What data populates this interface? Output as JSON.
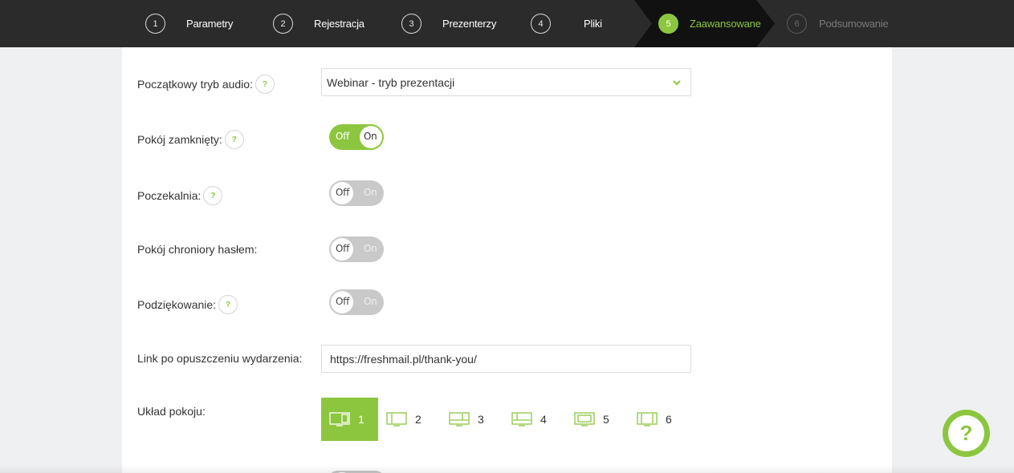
{
  "stepper": {
    "steps": [
      {
        "num": "1",
        "label": "Parametry"
      },
      {
        "num": "2",
        "label": "Rejestracja"
      },
      {
        "num": "3",
        "label": "Prezenterzy"
      },
      {
        "num": "4",
        "label": "Pliki"
      },
      {
        "num": "5",
        "label": "Zaawansowane"
      },
      {
        "num": "6",
        "label": "Podsumowanie"
      }
    ],
    "active_step": "5"
  },
  "form": {
    "audio_mode": {
      "label": "Początkowy tryb audio:",
      "value": "Webinar - tryb prezentacji"
    },
    "closed_room": {
      "label": "Pokój zamknięty:",
      "off": "Off",
      "on": "On",
      "state": "on"
    },
    "waiting_room": {
      "label": "Poczekalnia:",
      "off": "Off",
      "on": "On",
      "state": "off"
    },
    "password_room": {
      "label": "Pokój chroniory hasłem:",
      "off": "Off",
      "on": "On",
      "state": "off"
    },
    "thanks": {
      "label": "Podziękowanie:",
      "off": "Off",
      "on": "On",
      "state": "off"
    },
    "exit_link": {
      "label": "Link po opuszczeniu wydarzenia:",
      "value": "https://freshmail.pl/thank-you/"
    },
    "room_layout": {
      "label": "Układ pokoju:",
      "options": [
        "1",
        "2",
        "3",
        "4",
        "5",
        "6"
      ],
      "selected": "1"
    }
  },
  "help_symbol": "?",
  "colors": {
    "accent": "#8cc63f",
    "topbar": "#2b2b2b",
    "active_step_bg": "#111111",
    "toggle_off": "#c9c9c9"
  }
}
